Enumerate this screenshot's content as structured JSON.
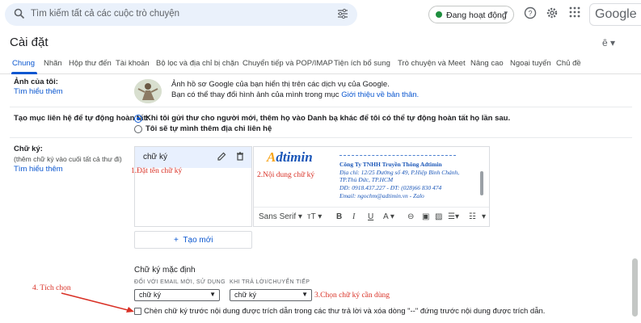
{
  "search": {
    "placeholder": "Tìm kiếm tất cả các cuộc trò chuyện"
  },
  "status": {
    "label": "Đang hoạt động",
    "color": "#1e8e3e"
  },
  "google_logo": "Google",
  "page_title": "Cài đặt",
  "tabs": [
    {
      "label": "Chung"
    },
    {
      "label": "Nhãn"
    },
    {
      "label": "Hộp thư đến"
    },
    {
      "label": "Tài khoản"
    },
    {
      "label": "Bộ lọc và địa chỉ bị chặn"
    },
    {
      "label": "Chuyển tiếp và POP/IMAP"
    },
    {
      "label": "Tiện ích bổ sung"
    },
    {
      "label": "Trò chuyện và Meet"
    },
    {
      "label": "Nâng cao"
    },
    {
      "label": "Ngoại tuyến"
    },
    {
      "label": "Chủ đề"
    }
  ],
  "picture": {
    "title": "Ảnh của tôi:",
    "learn_more": "Tìm hiểu thêm",
    "line1": "Ảnh hồ sơ Google của bạn hiển thị trên các dịch vụ của Google.",
    "line2_prefix": "Bạn có thể thay đổi hình ảnh của mình trong mục ",
    "line2_link": "Giới thiệu về bản thân."
  },
  "contacts": {
    "title": "Tạo mục liên hệ để tự động hoàn tất:",
    "option1": "Khi tôi gửi thư cho người mới, thêm họ vào Danh bạ khác để tôi có thể tự động hoàn tất họ lần sau.",
    "option2": "Tôi sẽ tự mình thêm địa chỉ liên hệ",
    "selected": 1
  },
  "signature": {
    "title": "Chữ ký:",
    "hint": "(thêm chữ ký vào cuối tất cả thư đi)",
    "learn_more": "Tìm hiểu thêm",
    "item_name": "chữ ký",
    "brand": {
      "first": "A",
      "rest": "dtimin"
    },
    "lines": {
      "company": "Công Ty TNHH Truyền Thông Adtimin",
      "address1": "Địa chỉ: 12/25 Đường số 49, P.Hiệp Bình Chánh,",
      "address2": "TP.Thủ Đức, TP.HCM",
      "phone": "DĐ: 0918.437.227 -  ĐT: (028)66 830 474",
      "email": "Email: ngochm@adtimin.vn -  Zalo"
    },
    "toolbar": {
      "font": "Sans Serif",
      "size": "тT",
      "bold": "B",
      "italic": "I",
      "underline": "U",
      "color": "A"
    },
    "create_new": "Tạo mới",
    "defaults_title": "Chữ ký mặc định",
    "new_email_caption": "ĐỐI VỚI EMAIL MỚI, SỬ DỤNG",
    "reply_caption": "KHI TRẢ LỜI/CHUYỂN TIẾP",
    "new_email_value": "chữ ký",
    "reply_value": "chữ ký",
    "insert_before_quote": "Chèn chữ ký trước nội dung được trích dẫn trong các thư trả lời và xóa dòng \"--\" đứng trước nội dung được trích dẫn."
  },
  "annotations": {
    "a1": "1.Đặt tên chữ ký",
    "a2": "2.Nội dung chữ ký",
    "a3": "3.Chọn chữ ký cần dùng",
    "a4": "4. Tích chọn"
  },
  "colors": {
    "accent": "#0b57d0",
    "annotation": "#d93025"
  }
}
